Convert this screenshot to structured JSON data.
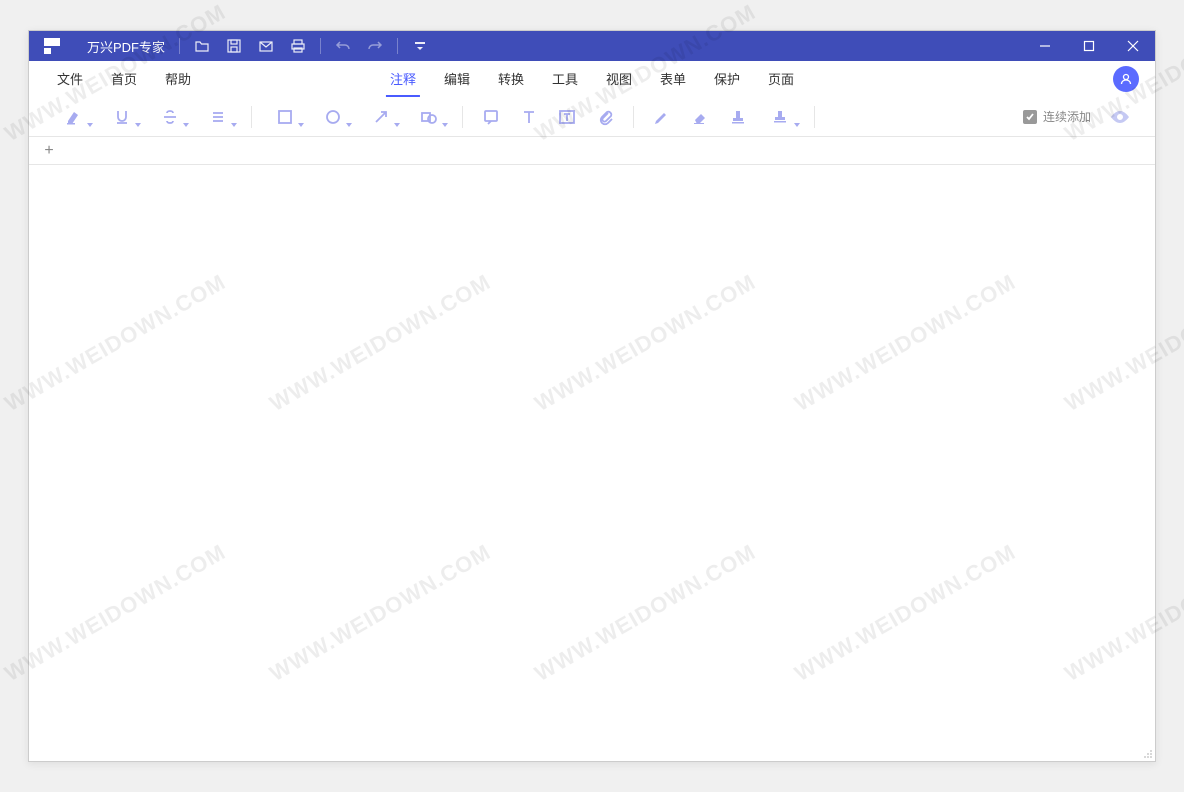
{
  "app_title": "万兴PDF专家",
  "menu_left": [
    "文件",
    "首页",
    "帮助"
  ],
  "menu_center": [
    "注释",
    "编辑",
    "转换",
    "工具",
    "视图",
    "表单",
    "保护",
    "页面"
  ],
  "active_tab": "注释",
  "checkbox_label": "连续添加",
  "watermark": "WWW.WEIDOWN.COM"
}
